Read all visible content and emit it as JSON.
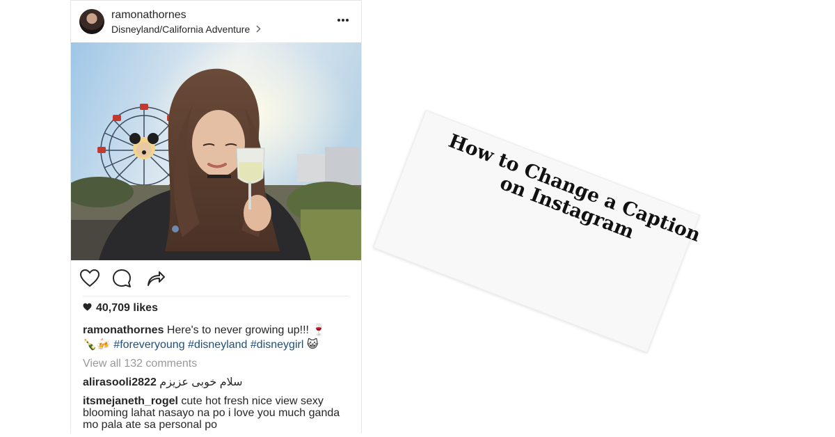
{
  "post": {
    "username": "ramonathornes",
    "location": "Disneyland/California Adventure",
    "likes": "40,709 likes",
    "caption_user": "ramonathornes",
    "caption_text": "Here's to never growing up!!! 🍷",
    "caption_emoji_start": "🍾🍻",
    "hashtags": [
      "#foreveryoung",
      "#disneyland",
      "#disneygirl"
    ],
    "caption_emoji_end": "😺",
    "view_all_comments": "View all 132 comments",
    "comments": [
      {
        "user": "alirasooli2822",
        "text": "سلام خوبی عزیزم"
      },
      {
        "user": "itsmejaneth_rogel",
        "text": "cute hot fresh nice view sexy blooming lahat nasayo na po i love you much ganda mo pala ate sa personal po"
      }
    ]
  },
  "card": {
    "title_line1": "How to Change a Caption",
    "title_line2": "on Instagram"
  },
  "icons": [
    "more-icon",
    "heart-icon",
    "comment-icon",
    "share-icon",
    "likes-heart-icon",
    "location-chevron-icon"
  ]
}
